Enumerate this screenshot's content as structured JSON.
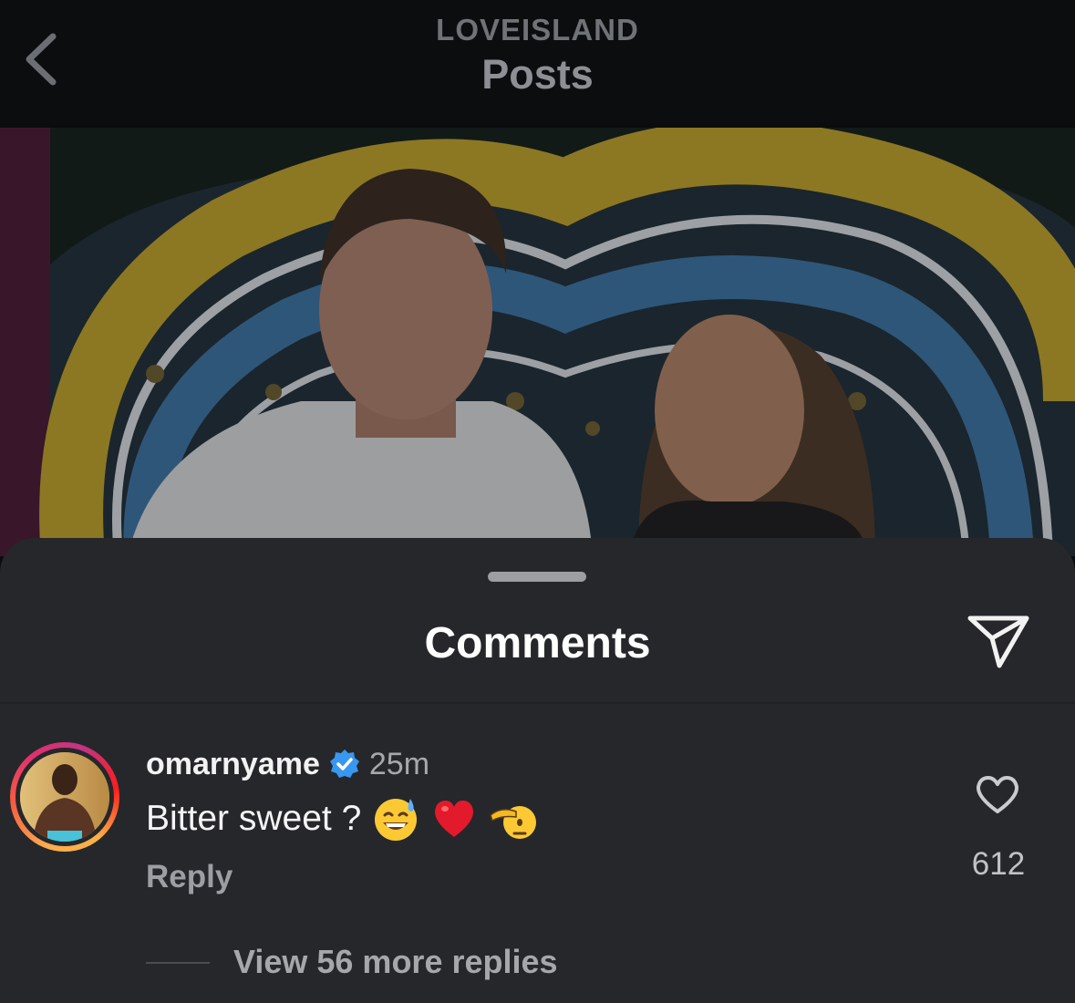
{
  "nav": {
    "account": "LOVEISLAND",
    "title": "Posts"
  },
  "post_image": {
    "description_icon": "photo-image"
  },
  "comments_sheet": {
    "title": "Comments",
    "share_icon": "paper-plane-icon"
  },
  "comment": {
    "username": "omarnyame",
    "verified": true,
    "time": "25m",
    "text": "Bitter sweet ?",
    "emojis": [
      "sweat-smile-emoji",
      "red-heart-emoji",
      "saluting-face-emoji"
    ],
    "reply_label": "Reply",
    "like_count": "612",
    "view_more_replies": "View 56 more replies"
  },
  "colors": {
    "sheet_background": "#25272b",
    "verified_blue": "#3897f0",
    "heart_red": "#e3192c"
  }
}
